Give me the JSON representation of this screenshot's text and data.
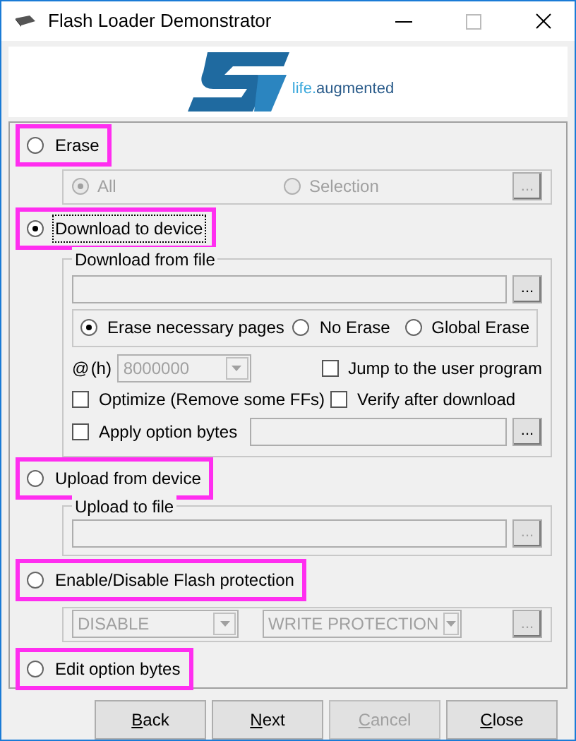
{
  "window": {
    "title": "Flash Loader Demonstrator"
  },
  "logo": {
    "tagline_a": "life.",
    "tagline_b": "augmented"
  },
  "erase": {
    "label": "Erase",
    "selected": false,
    "highlighted": true,
    "options": [
      {
        "label": "All",
        "selected": true,
        "disabled": true
      },
      {
        "label": "Selection",
        "selected": false,
        "disabled": true
      }
    ],
    "browse": {
      "label": "...",
      "disabled": true
    }
  },
  "download": {
    "label": "Download to device",
    "selected": true,
    "highlighted": true,
    "group": "Download from file",
    "browse": {
      "label": "...",
      "disabled": false
    },
    "erase_modes": [
      {
        "label": "Erase necessary pages",
        "selected": true
      },
      {
        "label": "No Erase",
        "selected": false
      },
      {
        "label": "Global Erase",
        "selected": false
      }
    ],
    "address": {
      "at": "@",
      "unit": "(h)",
      "value": "8000000",
      "disabled": true
    },
    "checks": [
      {
        "label": "Jump to the user program",
        "checked": false
      },
      {
        "label": "Optimize (Remove some FFs)",
        "checked": false
      },
      {
        "label": "Verify after download",
        "checked": false
      }
    ],
    "apply": {
      "label": "Apply option bytes",
      "checked": false,
      "browse": "..."
    }
  },
  "upload": {
    "label": "Upload from device",
    "selected": false,
    "highlighted": true,
    "group": "Upload to file",
    "browse": {
      "label": "...",
      "disabled": true
    }
  },
  "protection": {
    "label": "Enable/Disable Flash protection",
    "selected": false,
    "highlighted": true,
    "combos": [
      {
        "value": "DISABLE",
        "disabled": true
      },
      {
        "value": "WRITE PROTECTION",
        "disabled": true
      }
    ],
    "browse": {
      "label": "...",
      "disabled": true
    }
  },
  "edit": {
    "label": "Edit option bytes",
    "selected": false,
    "highlighted": true
  },
  "buttons": [
    {
      "label": "Back",
      "disabled": false
    },
    {
      "label": "Next",
      "disabled": false
    },
    {
      "label": "Cancel",
      "disabled": true
    },
    {
      "label": "Close",
      "disabled": false
    }
  ]
}
